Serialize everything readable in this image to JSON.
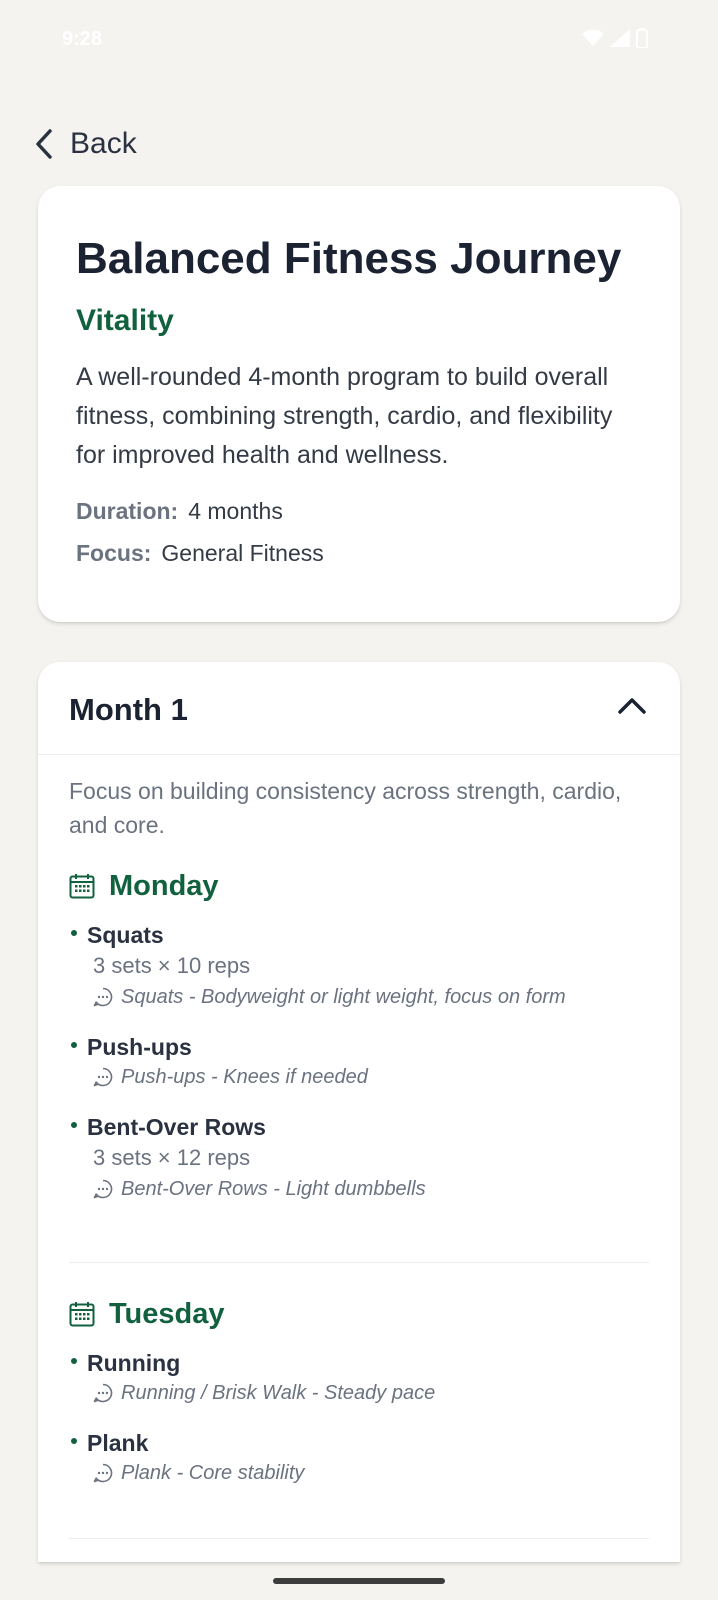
{
  "status": {
    "time": "9:28"
  },
  "nav": {
    "back_label": "Back"
  },
  "program": {
    "title": "Balanced Fitness Journey",
    "subtitle": "Vitality",
    "description": "A well-rounded 4-month program to build overall fitness, combining strength, cardio, and flexibility for improved health and wellness.",
    "duration_label": "Duration:",
    "duration_value": "4 months",
    "focus_label": "Focus:",
    "focus_value": "General Fitness"
  },
  "month": {
    "title": "Month 1",
    "description": "Focus on building consistency across strength, cardio, and core.",
    "days": [
      {
        "name": "Monday",
        "exercises": [
          {
            "name": "Squats",
            "sets": "3 sets × 10 reps",
            "note": "Squats - Bodyweight or light weight, focus on form"
          },
          {
            "name": "Push-ups",
            "note": "Push-ups - Knees if needed"
          },
          {
            "name": "Bent-Over Rows",
            "sets": "3 sets × 12 reps",
            "note": "Bent-Over Rows - Light dumbbells"
          }
        ]
      },
      {
        "name": "Tuesday",
        "exercises": [
          {
            "name": "Running",
            "note": "Running / Brisk Walk - Steady pace"
          },
          {
            "name": "Plank",
            "note": "Plank - Core stability"
          }
        ]
      }
    ]
  },
  "colors": {
    "accent": "#11613f",
    "background": "#f5f3ef"
  }
}
